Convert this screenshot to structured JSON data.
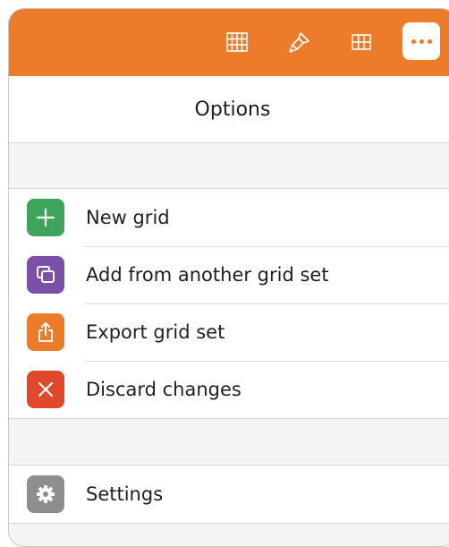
{
  "toolbar": {
    "icons": [
      "grid-cells-icon",
      "paint-brush-icon",
      "table-grid-icon",
      "more-icon"
    ],
    "accent_color": "#ec7c2a"
  },
  "panel": {
    "title": "Options"
  },
  "menu": {
    "items": [
      {
        "label": "New grid",
        "icon": "plus-icon",
        "color": "#3ea35b"
      },
      {
        "label": "Add from another grid set",
        "icon": "copy-icon",
        "color": "#7c4fa8"
      },
      {
        "label": "Export grid set",
        "icon": "export-icon",
        "color": "#ec7c2a"
      },
      {
        "label": "Discard changes",
        "icon": "close-icon",
        "color": "#e0482c"
      }
    ],
    "settings": {
      "label": "Settings",
      "icon": "gear-icon",
      "color": "#8e8e8e"
    }
  }
}
